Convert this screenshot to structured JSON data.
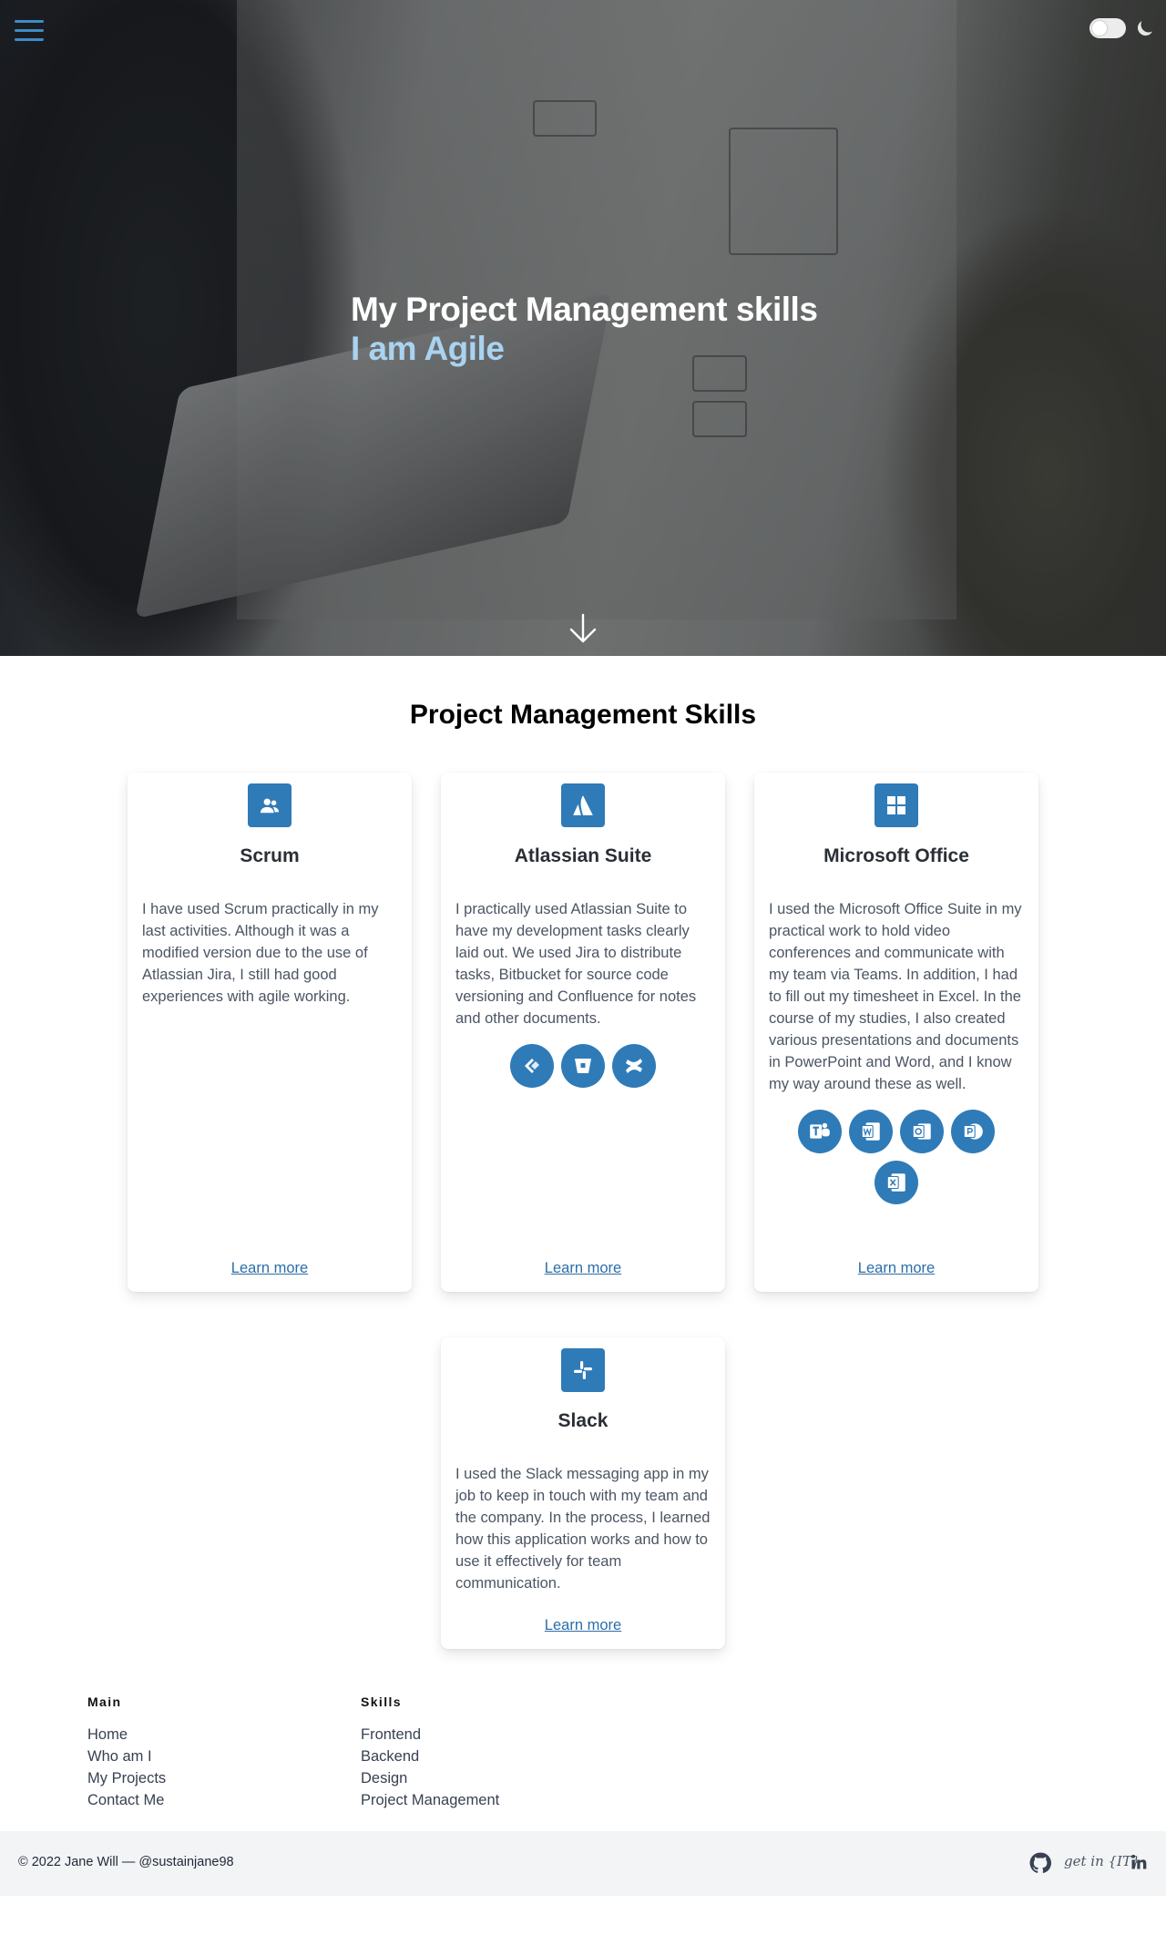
{
  "hero": {
    "title": "My Project Management skills",
    "subtitle": "I am Agile"
  },
  "icons": {
    "menu": "hamburger-menu-icon",
    "theme_toggle": "toggle-switch",
    "theme_mode": "moon-icon",
    "scroll": "arrow-down-icon"
  },
  "skills": {
    "heading": "Project Management Skills",
    "cards": [
      {
        "title": "Scrum",
        "icon": "users-icon",
        "text": "I have used Scrum practically in my last activities. Although it was a modified version due to the use of Atlassian Jira, I still had good experiences with agile working.",
        "link": "Learn more",
        "tools": []
      },
      {
        "title": "Atlassian Suite",
        "icon": "atlassian-icon",
        "text": "I practically used Atlassian Suite to have my development tasks clearly laid out. We used Jira to distribute tasks, Bitbucket for source code versioning and Confluence for notes and other documents.",
        "link": "Learn more",
        "tools": [
          "jira-icon",
          "bitbucket-icon",
          "confluence-icon"
        ]
      },
      {
        "title": "Microsoft Office",
        "icon": "windows-icon",
        "text": "I used the Microsoft Office Suite in my practical work to hold video conferences and communicate with my team via Teams. In addition, I had to fill out my timesheet in Excel. In the course of my studies, I also created various presentations and documents in PowerPoint and Word, and I know my way around these as well.",
        "link": "Learn more",
        "tools": [
          "teams-icon",
          "word-icon",
          "outlook-icon",
          "powerpoint-icon",
          "excel-icon"
        ]
      },
      {
        "title": "Slack",
        "icon": "slack-icon",
        "text": "I used the Slack messaging app in my job to keep in touch with my team and the company. In the process, I learned how this application works and how to use it effectively for team communication.",
        "link": "Learn more",
        "tools": []
      }
    ]
  },
  "footer": {
    "columns": [
      {
        "title": "Main",
        "links": [
          "Home",
          "Who am I",
          "My Projects",
          "Contact Me"
        ]
      },
      {
        "title": "Skills",
        "links": [
          "Frontend",
          "Backend",
          "Design",
          "Project Management"
        ]
      }
    ],
    "copyright": "© 2022 Jane Will — @sustainjane98",
    "social": {
      "getin": "get in {IT}",
      "icons": [
        "github-icon",
        "getinit-logo",
        "linkedin-icon"
      ]
    }
  },
  "colors": {
    "accent": "#2f7bb8",
    "hero_sub": "#a9d3f0",
    "link": "#2b6ea8"
  }
}
